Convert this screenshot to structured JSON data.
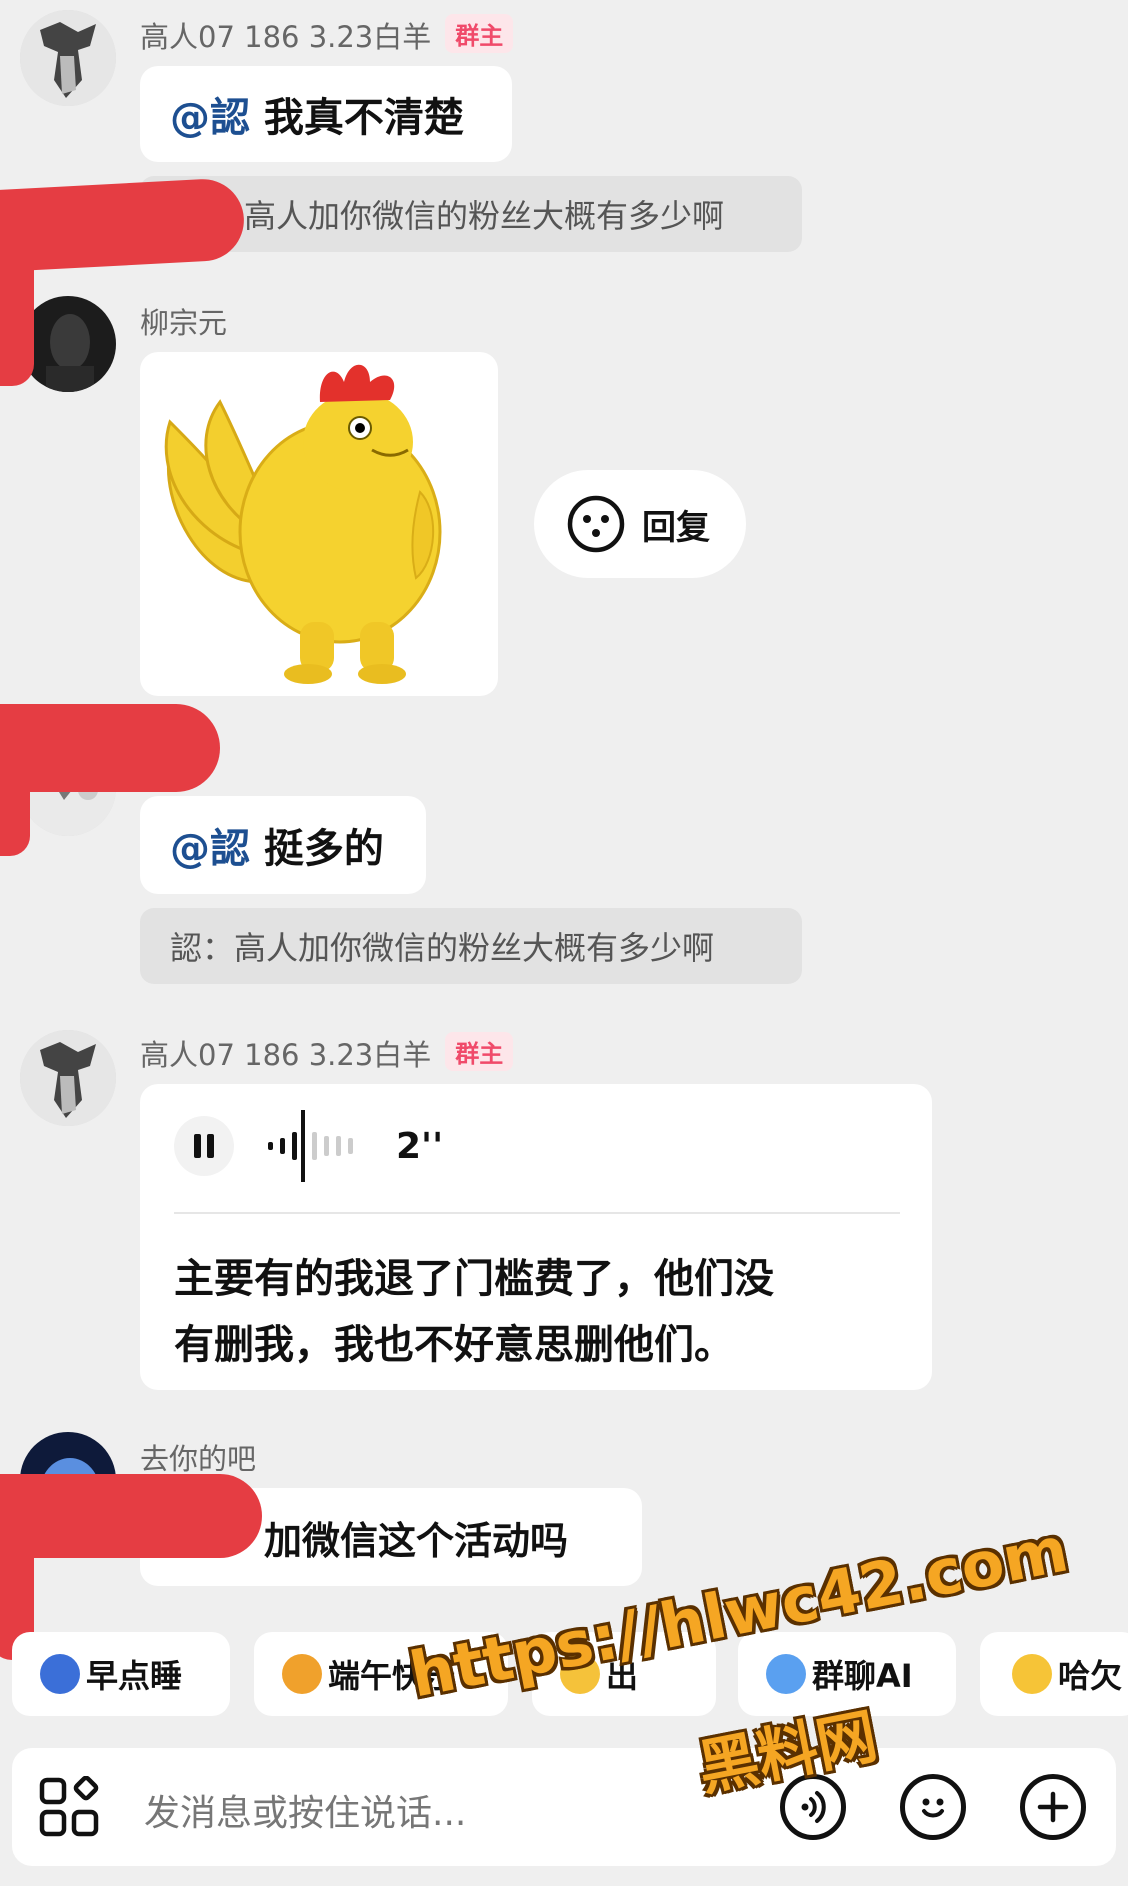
{
  "messages": [
    {
      "sender": "高人07  186  3.23白羊",
      "badge": "群主",
      "mention": "@認",
      "text": " 我真不清楚",
      "quote": "高人加你微信的粉丝大概有多少啊"
    },
    {
      "sender": "柳宗元",
      "reply_label": "回复"
    },
    {
      "mention": "@認",
      "text": " 挺多的",
      "quote": "認：高人加你微信的粉丝大概有多少啊"
    },
    {
      "sender": "高人07  186  3.23白羊",
      "badge": "群主",
      "voice_duration": "2''",
      "transcript_line1": "主要有的我退了门槛费了，他们没",
      "transcript_line2": "有删我，我也不好意思删他们。"
    },
    {
      "sender": "去你的吧",
      "text": "加微信这个活动吗"
    }
  ],
  "quick_replies": [
    {
      "label": "早点睡",
      "icon": "sleep-emoji-icon"
    },
    {
      "label": "端午快乐",
      "icon": "dragon-emoji-icon"
    },
    {
      "label": "出",
      "icon": "face-emoji-icon"
    },
    {
      "label": "群聊AI",
      "icon": "ai-emoji-icon"
    },
    {
      "label": "哈欠",
      "icon": "yawn-emoji-icon"
    }
  ],
  "input": {
    "placeholder": "发消息或按住说话..."
  },
  "watermark": {
    "url": "https://hlwc42.com",
    "site": "黑料网"
  },
  "colors": {
    "background": "#efefef",
    "mention": "#1d4f91",
    "badge": "#f04a6a",
    "redaction": "#e53d43",
    "watermark": "#f5a623"
  }
}
